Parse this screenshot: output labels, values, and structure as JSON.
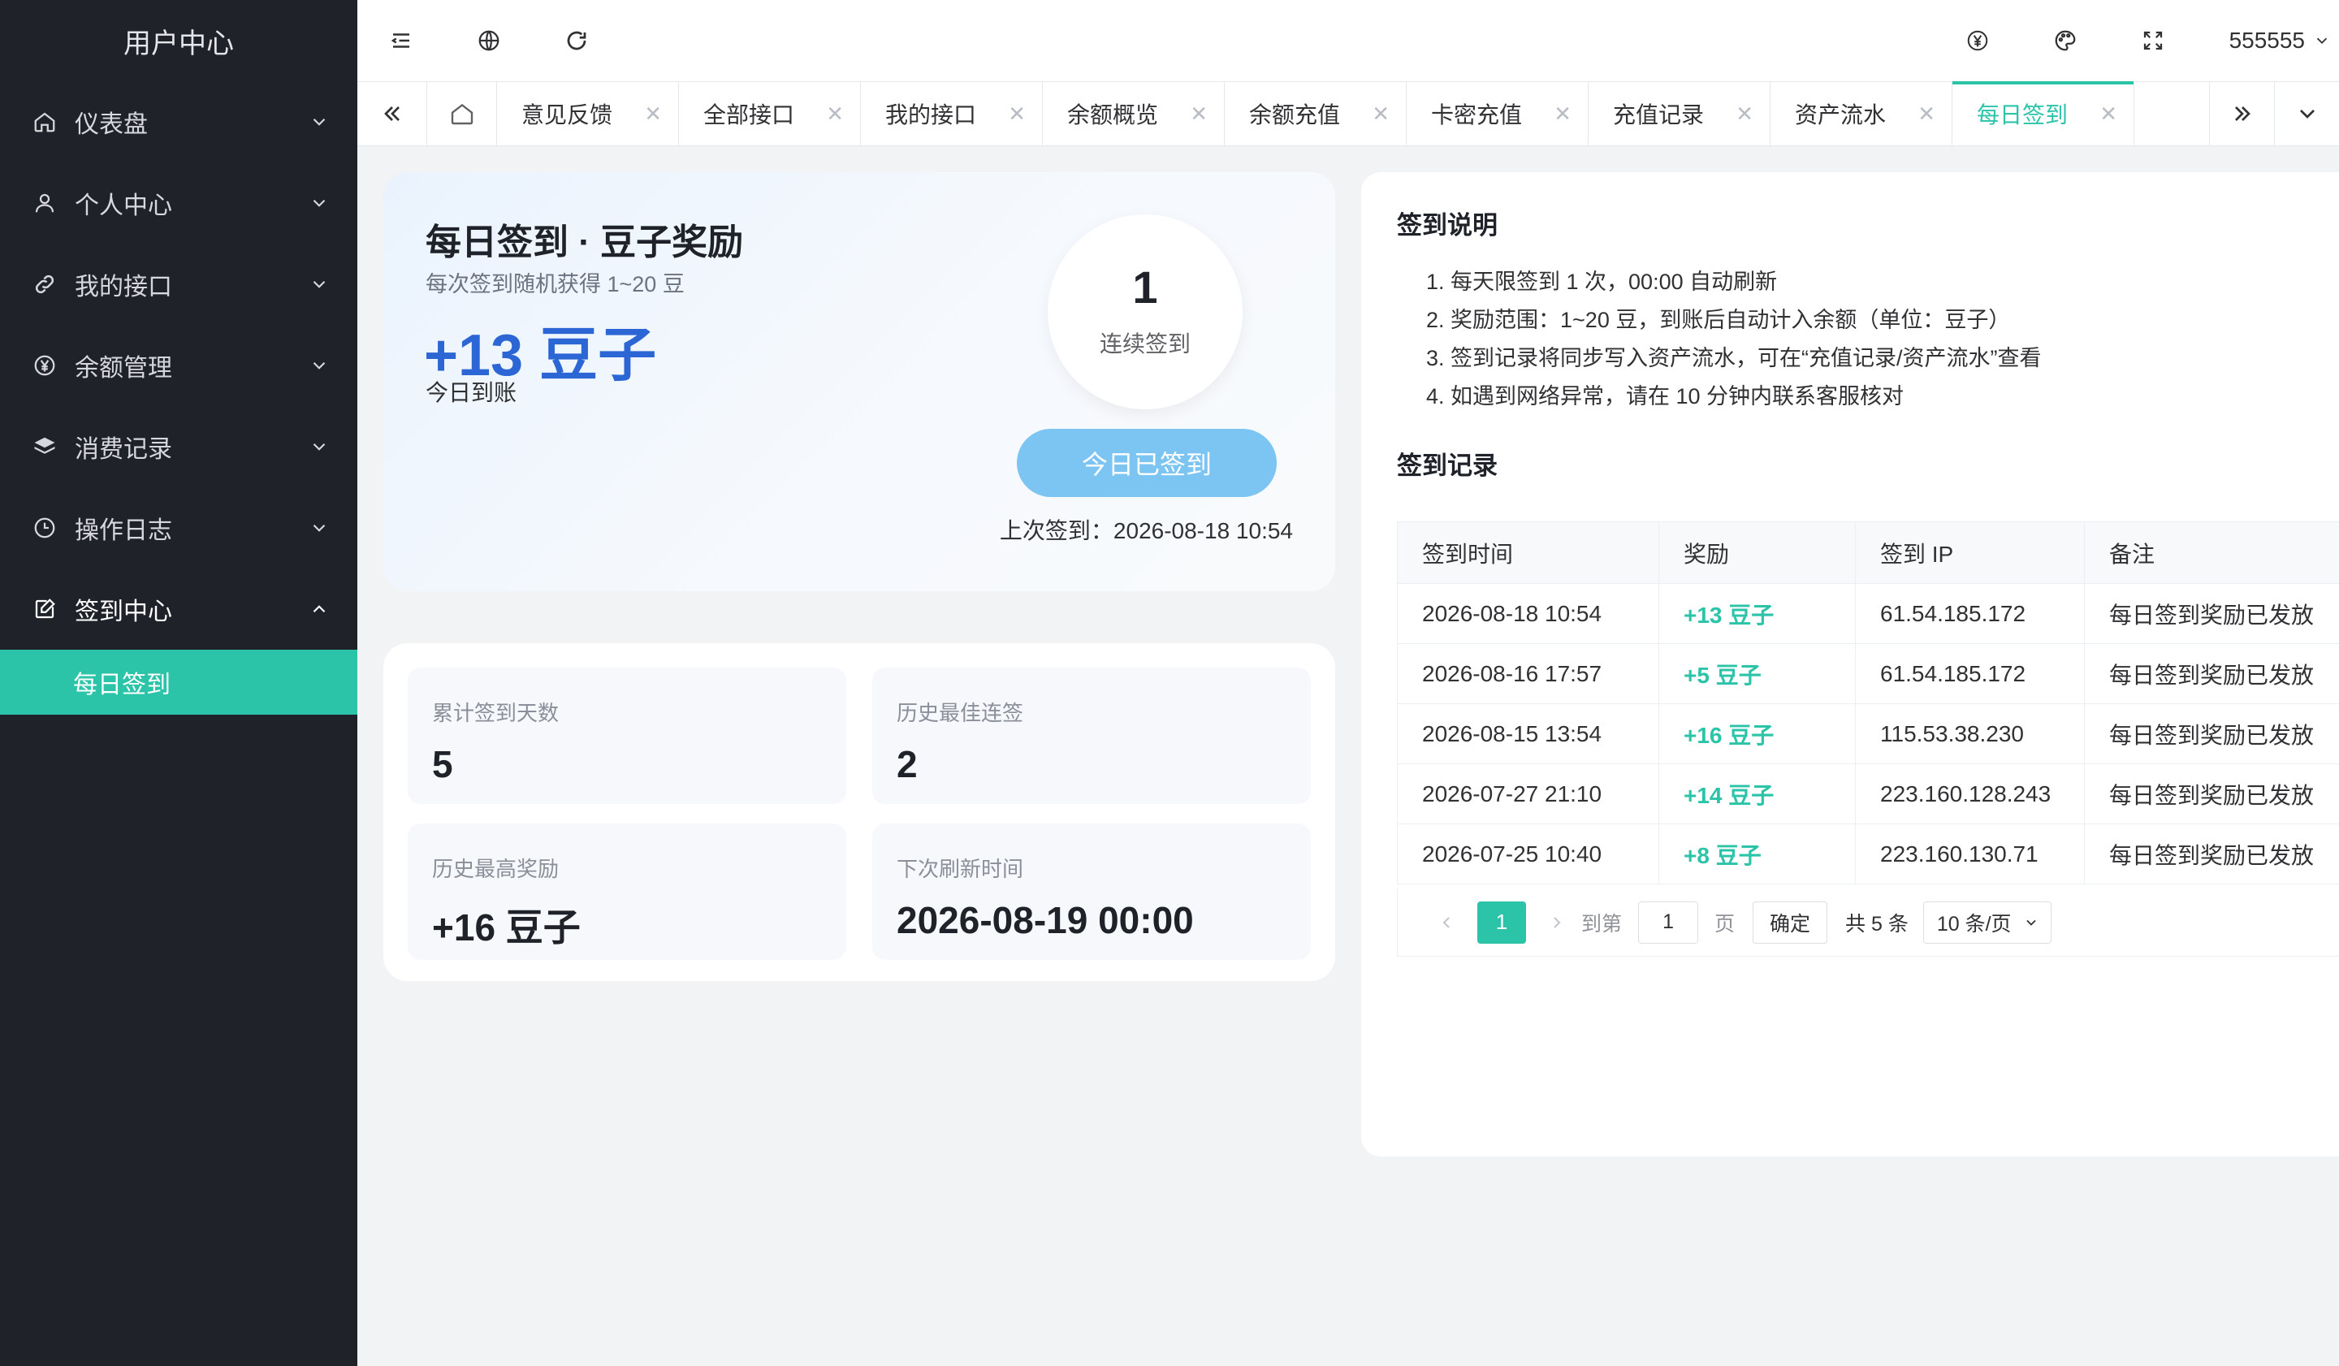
{
  "sidebar": {
    "title": "用户中心",
    "items": [
      {
        "label": "仪表盘",
        "icon": "home-icon"
      },
      {
        "label": "个人中心",
        "icon": "user-icon"
      },
      {
        "label": "我的接口",
        "icon": "link-icon"
      },
      {
        "label": "余额管理",
        "icon": "yen-icon"
      },
      {
        "label": "消费记录",
        "icon": "layers-icon"
      },
      {
        "label": "操作日志",
        "icon": "clock-icon"
      },
      {
        "label": "签到中心",
        "icon": "edit-icon"
      }
    ],
    "active_sub": "每日签到"
  },
  "header": {
    "username": "555555"
  },
  "tabs": [
    {
      "label": "意见反馈"
    },
    {
      "label": "全部接口"
    },
    {
      "label": "我的接口"
    },
    {
      "label": "余额概览"
    },
    {
      "label": "余额充值"
    },
    {
      "label": "卡密充值"
    },
    {
      "label": "充值记录"
    },
    {
      "label": "资产流水"
    },
    {
      "label": "每日签到",
      "active": true
    }
  ],
  "checkin": {
    "title": "每日签到 · 豆子奖励",
    "subtitle": "每次签到随机获得 1~20 豆",
    "amount": "+13 豆子",
    "amount_note": "今日到账",
    "streak_value": "1",
    "streak_label": "连续签到",
    "button_label": "今日已签到",
    "last_sign": "上次签到：2026-08-18 10:54"
  },
  "stats": [
    {
      "label": "累计签到天数",
      "value": "5"
    },
    {
      "label": "历史最佳连签",
      "value": "2"
    },
    {
      "label": "历史最高奖励",
      "value": "+16 豆子"
    },
    {
      "label": "下次刷新时间",
      "value": "2026-08-19 00:00"
    }
  ],
  "rules": {
    "title": "签到说明",
    "items": [
      "1. 每天限签到 1 次，00:00 自动刷新",
      "2. 奖励范围：1~20 豆，到账后自动计入余额（单位：豆子）",
      "3. 签到记录将同步写入资产流水，可在“充值记录/资产流水”查看",
      "4. 如遇到网络异常，请在 10 分钟内联系客服核对"
    ]
  },
  "records": {
    "title": "签到记录",
    "columns": [
      "签到时间",
      "奖励",
      "签到 IP",
      "备注"
    ],
    "rows": [
      [
        "2026-08-18 10:54",
        "+13 豆子",
        "61.54.185.172",
        "每日签到奖励已发放"
      ],
      [
        "2026-08-16 17:57",
        "+5 豆子",
        "61.54.185.172",
        "每日签到奖励已发放"
      ],
      [
        "2026-08-15 13:54",
        "+16 豆子",
        "115.53.38.230",
        "每日签到奖励已发放"
      ],
      [
        "2026-07-27 21:10",
        "+14 豆子",
        "223.160.128.243",
        "每日签到奖励已发放"
      ],
      [
        "2026-07-25 10:40",
        "+8 豆子",
        "223.160.130.71",
        "每日签到奖励已发放"
      ]
    ]
  },
  "pagination": {
    "current_page": "1",
    "goto_label": "到第",
    "goto_value": "1",
    "page_unit": "页",
    "confirm_label": "确定",
    "total": "共 5 条",
    "page_size": "10 条/页"
  },
  "colors": {
    "accent": "#2bc4a8",
    "sidebar_bg": "#1f2229",
    "amount_blue": "#2c66d4",
    "button_blue": "#7cc4f2"
  }
}
